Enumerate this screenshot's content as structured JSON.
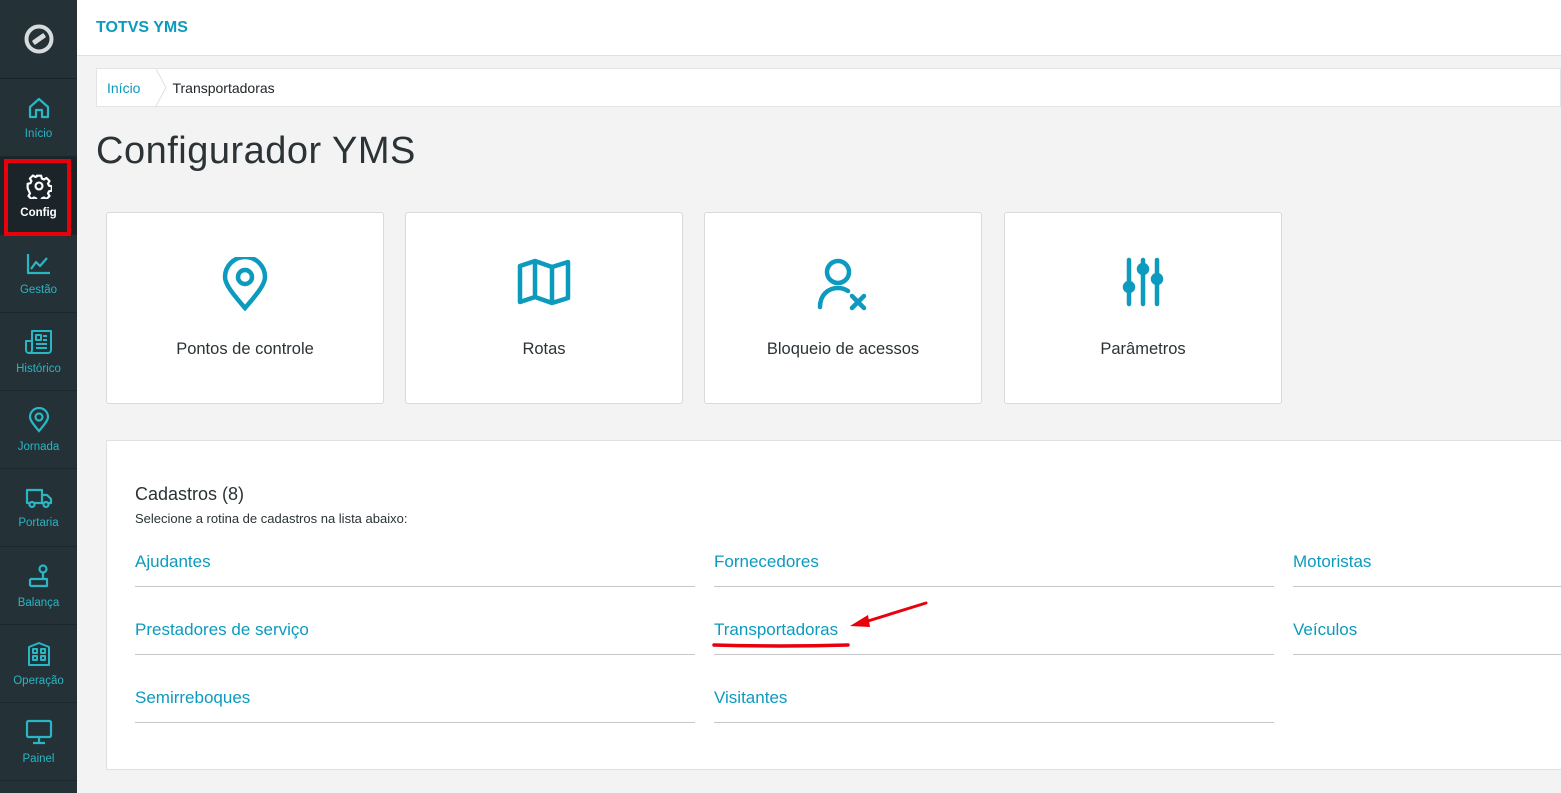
{
  "app": {
    "title": "TOTVS YMS"
  },
  "sidebar": {
    "items": [
      {
        "label": "Início",
        "icon": "home-icon"
      },
      {
        "label": "Config",
        "icon": "gear-icon",
        "active": true
      },
      {
        "label": "Gestão",
        "icon": "chart-icon"
      },
      {
        "label": "Histórico",
        "icon": "document-list-icon"
      },
      {
        "label": "Jornada",
        "icon": "map-pin-icon"
      },
      {
        "label": "Portaria",
        "icon": "truck-icon"
      },
      {
        "label": "Balança",
        "icon": "scale-icon"
      },
      {
        "label": "Operação",
        "icon": "building-icon"
      },
      {
        "label": "Painel",
        "icon": "monitor-icon"
      }
    ]
  },
  "breadcrumb": {
    "home": "Início",
    "current": "Transportadoras"
  },
  "page": {
    "title": "Configurador YMS"
  },
  "cards": [
    {
      "label": "Pontos de controle",
      "icon": "map-pin-icon"
    },
    {
      "label": "Rotas",
      "icon": "map-icon"
    },
    {
      "label": "Bloqueio de acessos",
      "icon": "user-block-icon"
    },
    {
      "label": "Parâmetros",
      "icon": "sliders-icon"
    }
  ],
  "cadastros": {
    "heading": "Cadastros (8)",
    "subtitle": "Selecione a rotina de cadastros na lista abaixo:",
    "links": [
      "Ajudantes",
      "Fornecedores",
      "Motoristas",
      "Prestadores de serviço",
      "Transportadoras",
      "Veículos",
      "Semirreboques",
      "Visitantes"
    ]
  },
  "colors": {
    "accent": "#0c9abe",
    "sidebar": "#243136",
    "sidebar_icon": "#29b6c5",
    "annotation": "#e8000b"
  }
}
